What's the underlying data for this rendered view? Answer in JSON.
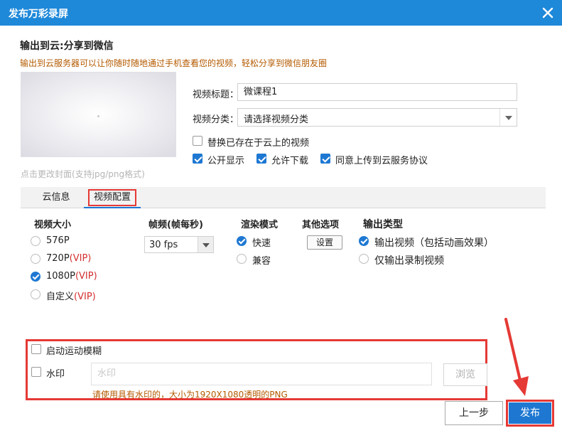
{
  "window": {
    "title": "发布万彩录屏",
    "close_icon": "close-icon"
  },
  "cloud": {
    "heading": "输出到云:分享到微信",
    "subheading": "输出到云服务器可以让你随时随地通过手机查看您的视频，轻松分享到微信朋友圈",
    "cover_hint": "点击更改封面(支持jpg/png格式)",
    "title_label": "视频标题：",
    "title_value": "微课程1",
    "category_label": "视频分类：",
    "category_value": "请选择视频分类",
    "options": [
      {
        "label": "替换已存在于云上的视频",
        "checked": false
      },
      {
        "label": "公开显示",
        "checked": true
      },
      {
        "label": "允许下载",
        "checked": true
      },
      {
        "label": "同意上传到云服务协议",
        "checked": true
      }
    ]
  },
  "tabs": [
    {
      "label": "云信息",
      "active": false
    },
    {
      "label": "视频配置",
      "active": true
    }
  ],
  "video_config": {
    "size": {
      "title": "视频大小",
      "options": [
        {
          "label": "576P",
          "vip": "",
          "selected": false
        },
        {
          "label": "720P",
          "vip": "(VIP)",
          "selected": false
        },
        {
          "label": "1080P",
          "vip": "(VIP)",
          "selected": true
        },
        {
          "label": "自定义",
          "vip": "(VIP)",
          "selected": false
        }
      ]
    },
    "fps": {
      "title": "帧频(帧每秒)",
      "value": "30 fps"
    },
    "render": {
      "title": "渲染模式",
      "options": [
        {
          "label": "快速",
          "selected": true
        },
        {
          "label": "兼容",
          "selected": false
        }
      ]
    },
    "other": {
      "title": "其他选项",
      "button_label": "设置"
    },
    "output": {
      "title": "输出类型",
      "options": [
        {
          "label": "输出视频（包括动画效果）",
          "selected": true
        },
        {
          "label": "仅输出录制视频",
          "selected": false
        }
      ]
    }
  },
  "extras": {
    "motion_blur_label": "启动运动模糊",
    "watermark_label": "水印",
    "watermark_placeholder": "水印",
    "browse_label": "浏览",
    "watermark_hint": "请使用具有水印的，大小为1920X1080透明的PNG"
  },
  "footer": {
    "prev_label": "上一步",
    "publish_label": "发布"
  },
  "colors": {
    "accent": "#1e78d2",
    "titlebar": "#1e88d9",
    "highlight": "#e53935",
    "hint": "#b35a00"
  }
}
